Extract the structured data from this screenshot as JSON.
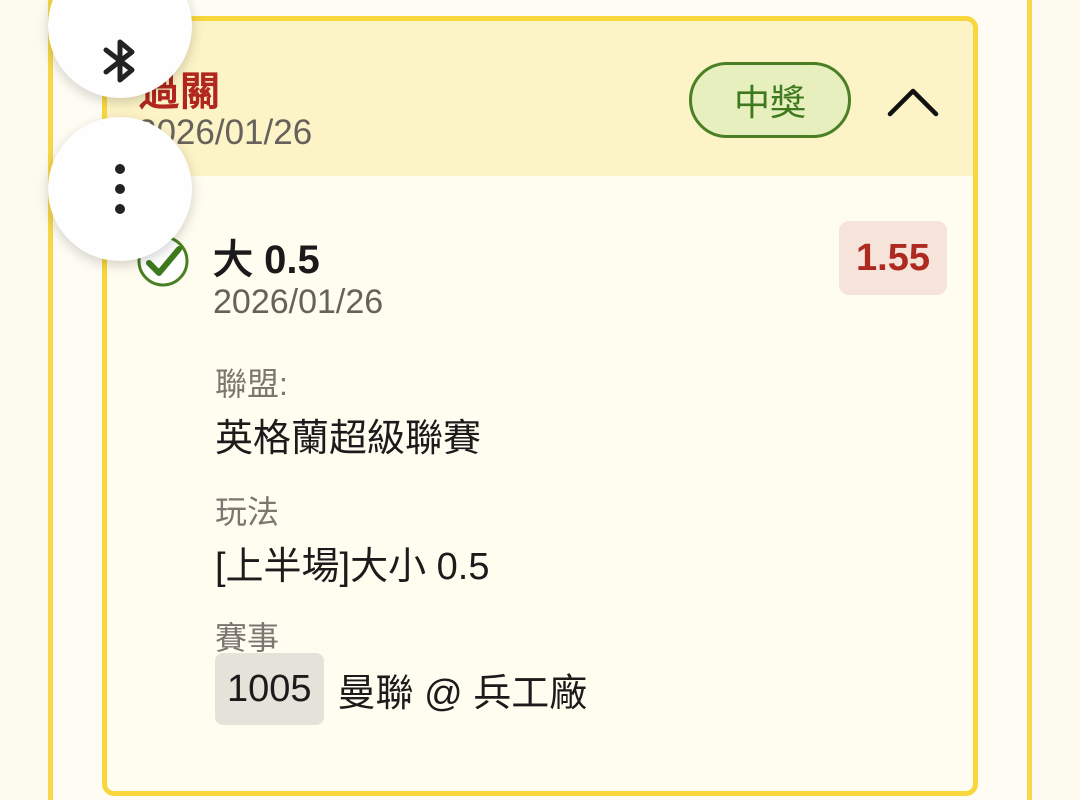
{
  "header": {
    "title": "過關",
    "date": "2026/01/26",
    "status_badge": "中獎"
  },
  "selection": {
    "label": "大 0.5",
    "date": "2026/01/26",
    "odds": "1.55"
  },
  "details": {
    "league_label": "聯盟:",
    "league_value": "英格蘭超級聯賽",
    "play_label": "玩法",
    "play_value": "[上半場]大小 0.5",
    "match_label": "賽事",
    "match_code": "1005",
    "match_name": "曼聯 @ 兵工廠"
  },
  "floating_buttons": {
    "bluetooth_icon": "bluetooth-icon",
    "more_icon": "more-vertical-icon"
  },
  "colors": {
    "card_border": "#f8d63c",
    "header_bg": "#fcf3c6",
    "title_red": "#b1261e",
    "win_green": "#3e7a1d",
    "odds_bg": "#f6e4da"
  }
}
